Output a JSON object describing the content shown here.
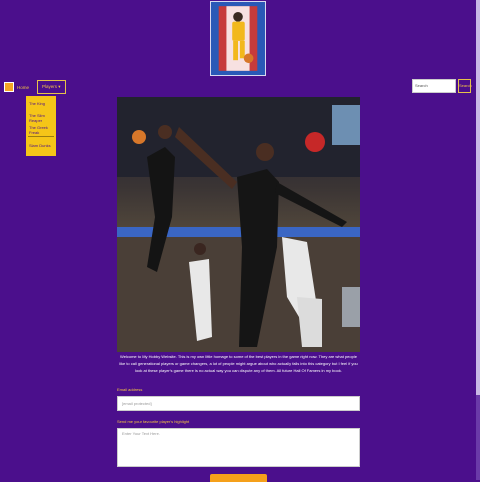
{
  "nav": {
    "home_label": "Home",
    "players_label": "Players ▾",
    "menu_items": [
      "The King",
      "The Slim Reaper",
      "The Greek Freak"
    ],
    "menu_footer": "Slam Dunks",
    "search_placeholder": "Search",
    "search_button": "Search"
  },
  "main": {
    "welcome_text": "Welcome to My Hobby Website. This is my own little homage to some of the best players in the game right now. They are what people like to call generational players or game changers, a lot of people might argue about who actually falls into this category but I feel if you look at these player's game there is no actual way you can dispute any of them. All future Hall Of Famers in my book."
  },
  "form": {
    "email_label": "Email address",
    "email_placeholder": "[email protected]",
    "highlight_label": "Send me your favourite player's highlight",
    "highlight_placeholder": "Enter Your Text Here."
  },
  "colors": {
    "background": "#4b0f8c",
    "accent": "#f5c518",
    "button": "#f5a01a"
  }
}
